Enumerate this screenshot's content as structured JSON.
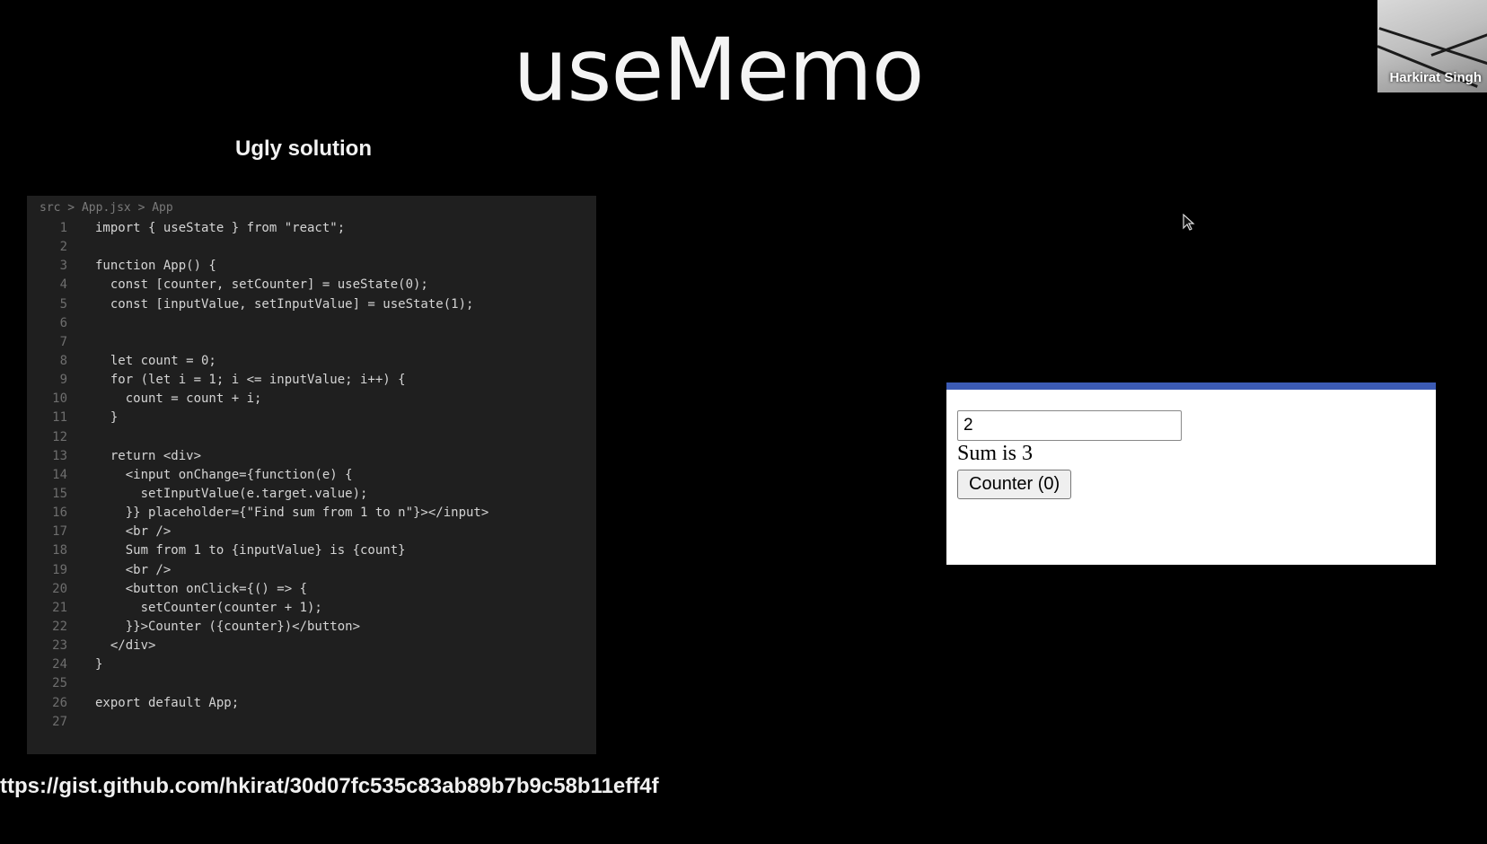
{
  "slide": {
    "title": "useMemo",
    "subtitle": "Ugly solution",
    "url": "ttps://gist.github.com/hkirat/30d07fc535c83ab89b7b9c58b11eff4f"
  },
  "webcam": {
    "name": "Harkirat Singh"
  },
  "editor": {
    "breadcrumb": "src > App.jsx > App",
    "lines": [
      {
        "n": "1",
        "code": "import { useState } from \"react\";"
      },
      {
        "n": "2",
        "code": ""
      },
      {
        "n": "3",
        "code": "function App() {"
      },
      {
        "n": "4",
        "code": "  const [counter, setCounter] = useState(0);"
      },
      {
        "n": "5",
        "code": "  const [inputValue, setInputValue] = useState(1);"
      },
      {
        "n": "6",
        "code": ""
      },
      {
        "n": "7",
        "code": ""
      },
      {
        "n": "8",
        "code": "  let count = 0;"
      },
      {
        "n": "9",
        "code": "  for (let i = 1; i <= inputValue; i++) {"
      },
      {
        "n": "10",
        "code": "    count = count + i;"
      },
      {
        "n": "11",
        "code": "  }"
      },
      {
        "n": "12",
        "code": ""
      },
      {
        "n": "13",
        "code": "  return <div>"
      },
      {
        "n": "14",
        "code": "    <input onChange={function(e) {"
      },
      {
        "n": "15",
        "code": "      setInputValue(e.target.value);"
      },
      {
        "n": "16",
        "code": "    }} placeholder={\"Find sum from 1 to n\"}></input>"
      },
      {
        "n": "17",
        "code": "    <br />"
      },
      {
        "n": "18",
        "code": "    Sum from 1 to {inputValue} is {count}"
      },
      {
        "n": "19",
        "code": "    <br />"
      },
      {
        "n": "20",
        "code": "    <button onClick={() => {"
      },
      {
        "n": "21",
        "code": "      setCounter(counter + 1);"
      },
      {
        "n": "22",
        "code": "    }}>Counter ({counter})</button>"
      },
      {
        "n": "23",
        "code": "  </div>"
      },
      {
        "n": "24",
        "code": "}"
      },
      {
        "n": "25",
        "code": ""
      },
      {
        "n": "26",
        "code": "export default App;"
      },
      {
        "n": "27",
        "code": ""
      }
    ]
  },
  "preview": {
    "input_value": "2",
    "sum_text": "Sum is 3",
    "counter_label": "Counter (0)"
  },
  "colors": {
    "background": "#000000",
    "editor_bg": "#1f1f1f",
    "preview_bar": "#3c5bb5"
  }
}
